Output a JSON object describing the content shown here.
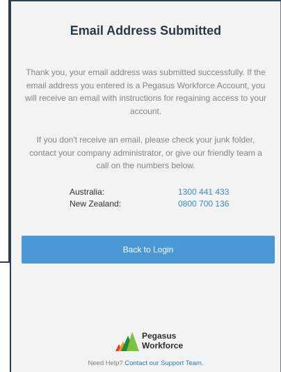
{
  "page": {
    "title": "Email Address Submitted",
    "paragraph_1": "Thank you, your email address was submitted successfully. If the email address you entered is a Pegasus Workforce Account, you will receive an email with instructions for regaining access to your account.",
    "paragraph_2": "If you don't receive an email, please check your junk folder, contact your company administrator, or give our friendly team a call on the numbers below."
  },
  "contacts": [
    {
      "label": "Australia:",
      "number": "1300 441 433"
    },
    {
      "label": "New Zealand:",
      "number": "0800 700 136"
    }
  ],
  "actions": {
    "back_label": "Back to Login"
  },
  "brand": {
    "line_1": "Pegasus",
    "line_2": "Workforce",
    "colors": {
      "accent": "#4a98d6",
      "link": "#3b8cc9",
      "logo_green_dark": "#1f8a3a",
      "logo_green_light": "#7cc242",
      "logo_orange": "#f39a1e",
      "logo_red": "#e23b2a"
    }
  },
  "footer": {
    "prefix": "Need Help?",
    "link_text": "Contact our Support Team."
  }
}
